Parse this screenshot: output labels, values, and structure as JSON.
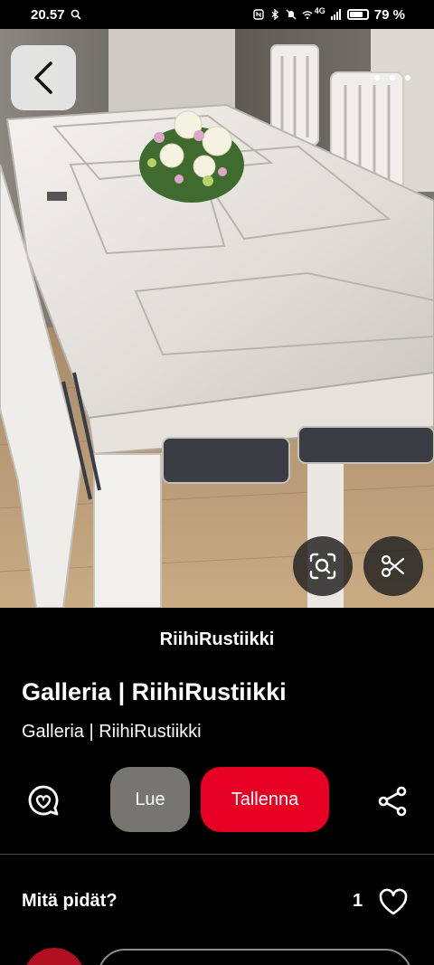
{
  "status_bar": {
    "time": "20.57",
    "network": "4G",
    "battery": "79 %"
  },
  "pin": {
    "source_name": "RiihiRustiikki",
    "title": "Galleria | RiihiRustiikki",
    "description": "Galleria | RiihiRustiikki",
    "image_description_icon": "photo"
  },
  "actions": {
    "read_label": "Lue",
    "save_label": "Tallenna"
  },
  "feedback": {
    "question": "Mitä pidät?",
    "like_count": "1"
  },
  "colors": {
    "save": "#e60023",
    "read": "#767570",
    "background": "#000000"
  },
  "icons": [
    "search-icon",
    "nfc-icon",
    "bluetooth-icon",
    "mute-icon",
    "wifi-icon",
    "signal-icon",
    "battery-icon",
    "back-icon",
    "more-icon",
    "visual-search-icon",
    "scissors-icon",
    "comment-icon",
    "share-icon",
    "heart-icon"
  ]
}
